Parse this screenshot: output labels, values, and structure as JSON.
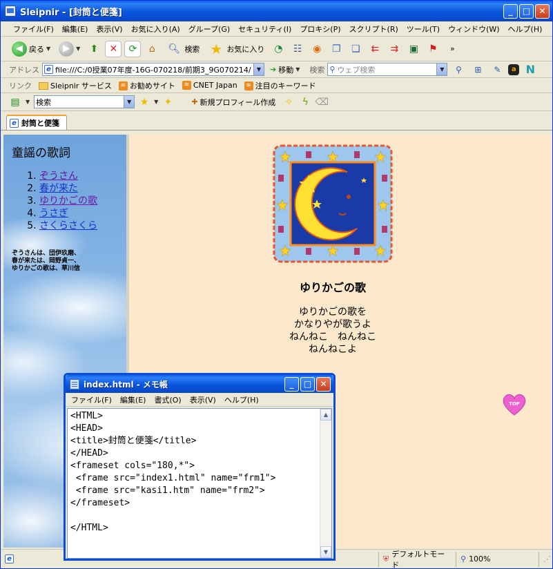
{
  "window": {
    "title": "Sleipnir - [封筒と便箋]"
  },
  "menu": [
    "ファイル(F)",
    "編集(E)",
    "表示(V)",
    "お気に入り(A)",
    "グループ(G)",
    "セキュリティ(I)",
    "プロキシ(P)",
    "スクリプト(R)",
    "ツール(T)",
    "ウィンドウ(W)",
    "ヘルプ(H)"
  ],
  "toolbar": {
    "back": "戻る",
    "search": "検索",
    "favorites": "お気に入り"
  },
  "address": {
    "label": "アドレス",
    "url": "file:///C:/0授業07年度-16G-070218/前期3_9G070214/",
    "go": "移動",
    "search_label": "検索",
    "web_search_placeholder": "ウェブ検索"
  },
  "links": {
    "label": "リンク",
    "items": [
      "Sleipnir サービス",
      "お勧めサイト",
      "CNET Japan",
      "注目のキーワード"
    ]
  },
  "searchbar": {
    "combo": "検索",
    "new_profile": "新規プロフィール作成"
  },
  "tab": {
    "label": "封筒と便箋"
  },
  "left_frame": {
    "heading": "童謡の歌詞",
    "songs": [
      "ぞうさん",
      "春が来た",
      "ゆりかごの歌",
      "うさぎ",
      "さくらさくら"
    ],
    "note": [
      "ぞうさんは、団伊玖磨、",
      "春が来たは、岡野貞一、",
      "ゆりかごの歌は、草川信"
    ]
  },
  "right_frame": {
    "title": "ゆりかごの歌",
    "lyrics": [
      "ゆりかごの歌を",
      "かなりやが歌うよ",
      "ねんねこ　ねんねこ",
      "ねんねこよ"
    ],
    "top_label": "TOP"
  },
  "notepad": {
    "title": "index.html - メモ帳",
    "menu": [
      "ファイル(F)",
      "編集(E)",
      "書式(O)",
      "表示(V)",
      "ヘルプ(H)"
    ],
    "lines": [
      "<HTML>",
      "<HEAD>",
      "<title>封筒と便箋</title>",
      "</HEAD>",
      "<frameset cols=\"180,*\">",
      " <frame src=\"index1.html\" name=\"frm1\">",
      " <frame src=\"kasi1.htm\" name=\"frm2\">",
      "</frameset>",
      "",
      "</HTML>"
    ]
  },
  "status": {
    "mode": "デフォルトモード",
    "zoom": "100%"
  },
  "colors": {
    "title_blue": "#0a55de",
    "frame_bg": "#fde8cc",
    "sky_blue": "#8ab8e6",
    "moon_yellow": "#ffe033"
  }
}
